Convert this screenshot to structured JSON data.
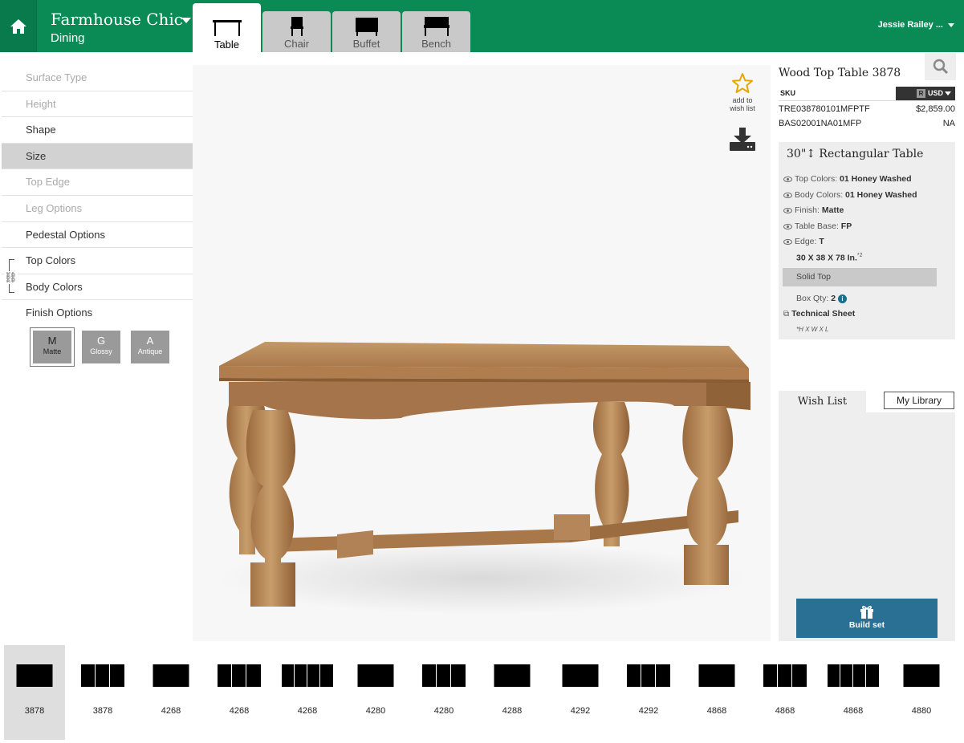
{
  "header": {
    "collection": "Farmhouse Chic",
    "room": "Dining",
    "tabs": [
      {
        "label": "Table",
        "icon": "table-icon"
      },
      {
        "label": "Chair",
        "icon": "chair-icon"
      },
      {
        "label": "Buffet",
        "icon": "buffet-icon"
      },
      {
        "label": "Bench",
        "icon": "bench-icon"
      }
    ],
    "user": "Jessie Railey ...",
    "brand_color": "#0a8a55"
  },
  "menu": {
    "items": [
      {
        "label": "Surface Type"
      },
      {
        "label": "Height"
      },
      {
        "label": "Shape"
      },
      {
        "label": "Size"
      },
      {
        "label": "Top Edge"
      },
      {
        "label": "Leg Options"
      },
      {
        "label": "Pedestal Options"
      },
      {
        "label": "Top Colors"
      },
      {
        "label": "Body Colors"
      },
      {
        "label": "Finish Options"
      }
    ],
    "finishes": [
      {
        "letter": "M",
        "word": "Matte"
      },
      {
        "letter": "G",
        "word": "Glossy"
      },
      {
        "letter": "A",
        "word": "Antique"
      }
    ]
  },
  "viewer": {
    "wish_add": "add to wish list"
  },
  "product": {
    "title": "Wood Top Table 3878",
    "sku_label": "SKU",
    "currency_badge": "R",
    "currency": "USD",
    "skus": [
      {
        "code": "TRE038780101MFPTF",
        "value": "$2,859.00"
      },
      {
        "code": "BAS02001NA01MFP",
        "value": "NA"
      }
    ],
    "spec_title": "30\"↕ Rectangular Table",
    "specs": [
      {
        "label": "Top Colors:",
        "value": "01 Honey Washed"
      },
      {
        "label": "Body Colors:",
        "value": "01 Honey Washed"
      },
      {
        "label": "Finish:",
        "value": "Matte"
      },
      {
        "label": "Table Base:",
        "value": "FP"
      },
      {
        "label": "Edge:",
        "value": "T"
      }
    ],
    "dimensions": "30 X 38 X 78 In.",
    "dimensions_sup": "*2",
    "top_type": "Solid Top",
    "box_qty_label": "Box Qty:",
    "box_qty": "2",
    "tech_sheet": "Technical Sheet",
    "dim_note": "*H X W X L"
  },
  "wishlist": {
    "tab_wish": "Wish List",
    "tab_library": "My Library",
    "build_label": "Build set",
    "build_color": "#2a6f94"
  },
  "models": [
    {
      "label": "3878",
      "segments": 1
    },
    {
      "label": "3878",
      "segments": 3
    },
    {
      "label": "4268",
      "segments": 1
    },
    {
      "label": "4268",
      "segments": 3
    },
    {
      "label": "4268",
      "segments": 4
    },
    {
      "label": "4280",
      "segments": 1
    },
    {
      "label": "4280",
      "segments": 3
    },
    {
      "label": "4288",
      "segments": 1
    },
    {
      "label": "4292",
      "segments": 1
    },
    {
      "label": "4292",
      "segments": 3
    },
    {
      "label": "4868",
      "segments": 1
    },
    {
      "label": "4868",
      "segments": 3
    },
    {
      "label": "4868",
      "segments": 4
    },
    {
      "label": "4880",
      "segments": 1
    }
  ]
}
